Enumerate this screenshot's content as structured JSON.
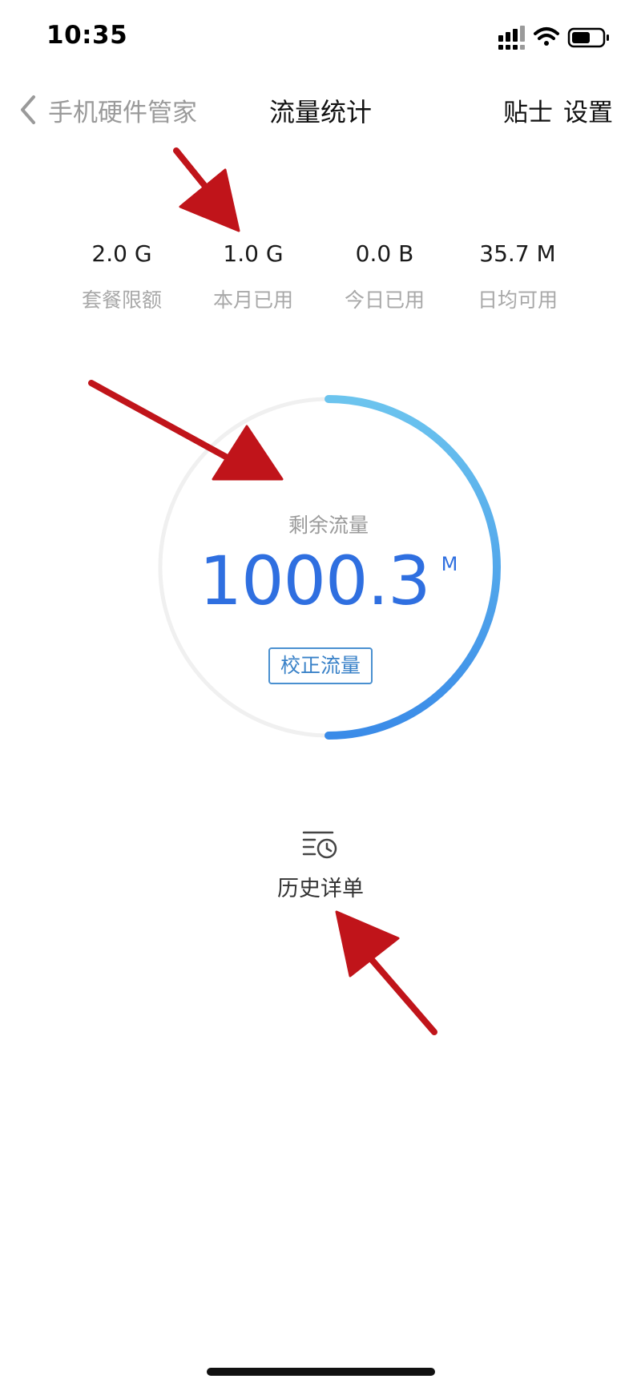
{
  "status_bar": {
    "time": "10:35"
  },
  "nav": {
    "back_label": "手机硬件管家",
    "title": "流量统计",
    "tips": "贴士",
    "settings": "设置"
  },
  "stats": [
    {
      "value": "2.0 G",
      "caption": "套餐限额"
    },
    {
      "value": "1.0 G",
      "caption": "本月已用"
    },
    {
      "value": "0.0 B",
      "caption": "今日已用"
    },
    {
      "value": "35.7 M",
      "caption": "日均可用"
    }
  ],
  "gauge": {
    "label": "剩余流量",
    "value": "1000.3",
    "unit": "M",
    "remaining_fraction": 0.5,
    "calibrate": "校正流量"
  },
  "history": {
    "label": "历史详单"
  },
  "colors": {
    "accent": "#2f6fe0",
    "arc_start": "#6cc4ee",
    "arc_end": "#3a8be8",
    "track": "#f0f0f0",
    "arrow": "#c0141a"
  }
}
